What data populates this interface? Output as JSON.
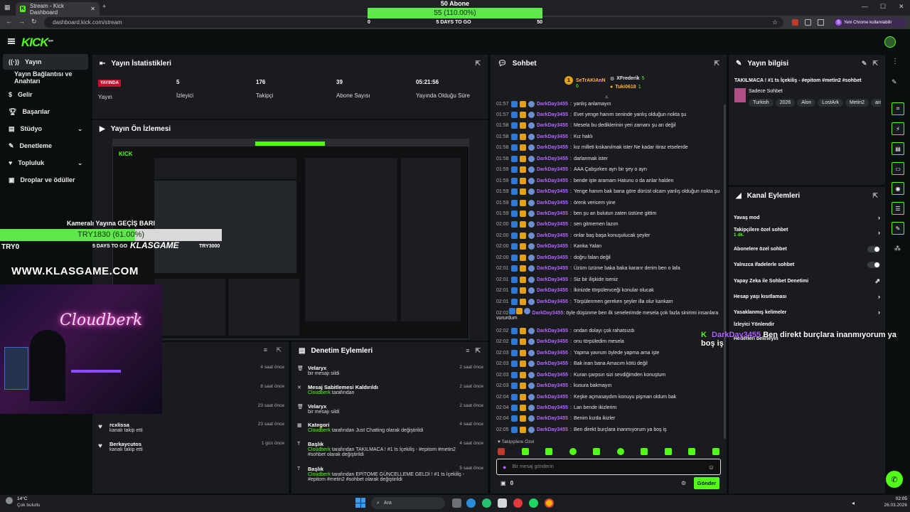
{
  "browser": {
    "tab_title": "Stream - Kick Dashboard",
    "new_tab": "+",
    "url": "dashboard.kick.com/stream",
    "profile_label": "Yeni Chrome kullanılabilir",
    "profile_initial": "S"
  },
  "goal_overlay": {
    "title": "50 Abone",
    "progress_label": "55 (110.00%)",
    "progress_fraction": 1.0,
    "min": "0",
    "days": "5 DAYS TO GO",
    "max": "50"
  },
  "header": {
    "logo": "KICK",
    "logo_sup": "BETA"
  },
  "sidebar": {
    "items": [
      {
        "label": "Yayın",
        "icon": "broadcast-icon"
      },
      {
        "label": "Yayın Bağlantısı ve Anahtarı",
        "icon": ""
      },
      {
        "label": "Gelir",
        "icon": "dollar-icon"
      },
      {
        "label": "Başarılar",
        "icon": "trophy-icon"
      },
      {
        "label": "Stüdyo",
        "icon": "studio-icon"
      },
      {
        "label": "Denetleme",
        "icon": "wrench-icon"
      },
      {
        "label": "Topluluk",
        "icon": "community-icon"
      },
      {
        "label": "Droplar ve ödüller",
        "icon": "gift-icon"
      }
    ]
  },
  "stats_panel": {
    "title": "Yayın İstatistikleri",
    "live_badge": "YAYINDA",
    "live_label": "Yayın",
    "stats": [
      {
        "value": "5",
        "label": "İzleyici"
      },
      {
        "value": "176",
        "label": "Takipçi"
      },
      {
        "value": "39",
        "label": "Abone Sayısı"
      },
      {
        "value": "05:21:56",
        "label": "Yayında Olduğu Süre"
      }
    ]
  },
  "preview_panel": {
    "title": "Yayın Ön İzlemesi"
  },
  "webcam_overlay": {
    "goal_title": "Kameralı Yayına GEÇİŞ BARI",
    "goal_value": "TRY1830 (61.00%)",
    "goal_fraction": 0.61,
    "min": "TRY0",
    "days": "5 DAYS TO GO",
    "max": "TRY3000",
    "sponsor": "KLASGAME",
    "sponsor_url": "WWW.KLASGAME.COM",
    "neon_sign": "Cloudberk"
  },
  "activity_panel": {
    "rows": [
      {
        "title": "",
        "sub": "",
        "time": "4 saat önce"
      },
      {
        "title": "",
        "sub": "",
        "time": "8 saat önce"
      },
      {
        "title": "",
        "sub": "",
        "time": "23 saat önce"
      },
      {
        "title": "rcxlissa",
        "sub": "kanalı takip etti",
        "time": "23 saat önce"
      },
      {
        "title": "Berkaycutos",
        "sub": "kanalı takip etti",
        "time": "1 gün önce"
      }
    ]
  },
  "moderation_panel": {
    "title": "Denetim Eylemleri",
    "rows": [
      {
        "title": "Velaryx",
        "actor": "",
        "sub": "bir mesajı sildi",
        "time": "2 saat önce"
      },
      {
        "title": "Mesaj Sabitlemesi Kaldırıldı",
        "actor": "Cloudberk",
        "sub": "tarafından",
        "time": "2 saat önce"
      },
      {
        "title": "Velaryx",
        "actor": "",
        "sub": "bir mesajı sildi",
        "time": "2 saat önce"
      },
      {
        "title": "Kategori",
        "actor": "Cloudberk",
        "sub": "tarafından Just Chatting olarak değiştirildi",
        "time": "4 saat önce"
      },
      {
        "title": "Başlık",
        "actor": "Cloudberk",
        "sub": "tarafından TAKILMACA ! #1 ts İçekiliş - #epitom #metin2 #sohbet olarak değiştirildi",
        "time": "4 saat önce"
      },
      {
        "title": "Başlık",
        "actor": "Cloudberk",
        "sub": "tarafından EPİTOME GÜNCELLEME GELDİ ! #1 ts İçekiliş - #epitom #metin2 #sohbet olarak değiştirildi",
        "time": "5 saat önce"
      }
    ]
  },
  "chat": {
    "title": "Sohbet",
    "top_gifters": [
      {
        "rank": "1",
        "name": "SeTrAKIAnN",
        "count": "6"
      },
      {
        "rank": "",
        "name": "XFrederik",
        "count": "5"
      },
      {
        "rank": "",
        "name": "Tuki0618",
        "count": "1"
      }
    ],
    "messages": [
      {
        "time": "01:57",
        "user": "DarkDay3455",
        "text": "yanlış anlamayın"
      },
      {
        "time": "01:57",
        "user": "DarkDay3455",
        "text": "Evet yenge hanım seninde yanlış olduğun nokta şu"
      },
      {
        "time": "01:58",
        "user": "DarkDay3455",
        "text": "Mesela bu dediklerinin yeri zamanı şu an değil"
      },
      {
        "time": "01:58",
        "user": "DarkDay3455",
        "text": "Kız haklı"
      },
      {
        "time": "01:58",
        "user": "DarkDay3455",
        "text": "kız milleti kıskanılmak ister Ne kadar itiraz etselerde"
      },
      {
        "time": "01:58",
        "user": "DarkDay3455",
        "text": "darlanmak ister"
      },
      {
        "time": "01:59",
        "user": "DarkDay3455",
        "text": "AAA Çabşırken ayrı bir şey o ayrı"
      },
      {
        "time": "01:59",
        "user": "DarkDay3455",
        "text": "bende işte aramam Hatunu o da anlar halden"
      },
      {
        "time": "01:59",
        "user": "DarkDay3455",
        "text": "Yenge hanım bak bana göre dürüst olcam yanlış olduğun nokta şu"
      },
      {
        "time": "01:59",
        "user": "DarkDay3455",
        "text": "örenk vericem yine"
      },
      {
        "time": "01:59",
        "user": "DarkDay3455",
        "text": "ben şu an bulutun zaten üstüne gittim"
      },
      {
        "time": "02:00",
        "user": "DarkDay3455",
        "text": "sen gitmemen lazım"
      },
      {
        "time": "02:00",
        "user": "DarkDay3455",
        "text": "onlar baş başa konuşulucak şeyler"
      },
      {
        "time": "02:00",
        "user": "DarkDay3455",
        "text": "Kanka Yalan"
      },
      {
        "time": "02:00",
        "user": "DarkDay3455",
        "text": "doğru falan değil"
      },
      {
        "time": "02:01",
        "user": "DarkDay3455",
        "text": "Üzüm üzüme baka baka kararır derim ben o lafa"
      },
      {
        "time": "02:01",
        "user": "DarkDay3455",
        "text": "Siz bir ilişkide iseniz"
      },
      {
        "time": "02:01",
        "user": "DarkDay3455",
        "text": "İkinizde törpülenıceği konular olucak"
      },
      {
        "time": "02:01",
        "user": "DarkDay3455",
        "text": "Törpülenmen gereken şeyler illa olur kankam"
      },
      {
        "time": "02:02",
        "user": "DarkDay3455",
        "text": "öyle düşünme ben ilk senelerimde mesela çok fazla sinirimi insanlara vururdum"
      },
      {
        "time": "02:02",
        "user": "DarkDay3455",
        "text": "ondan dolayı çok rahatsızdı"
      },
      {
        "time": "02:02",
        "user": "DarkDay3455",
        "text": "onu törpüledim mesela"
      },
      {
        "time": "02:03",
        "user": "DarkDay3455",
        "text": "Yapma yavrum öylede yapma ama işte"
      },
      {
        "time": "02:03",
        "user": "DarkDay3455",
        "text": "Bak inan bana Amacım kötü değil"
      },
      {
        "time": "02:03",
        "user": "DarkDay3455",
        "text": "Kuran çarpsın sizi sevdiğimden konuştum"
      },
      {
        "time": "02:03",
        "user": "DarkDay3455",
        "text": "kusura bakmayın"
      },
      {
        "time": "02:04",
        "user": "DarkDay3455",
        "text": "Keşke açmasaydım konuyu pişman oldum bak"
      },
      {
        "time": "02:04",
        "user": "DarkDay3455",
        "text": "Lan bende ikizlerim"
      },
      {
        "time": "02:04",
        "user": "DarkDay3455",
        "text": "Benim kızda ikizler"
      },
      {
        "time": "02:05",
        "user": "DarkDay3455",
        "text": "Ben direkt burçlara inanmıyorum ya boş iş"
      }
    ],
    "followers_only": "Takipçilere Özel",
    "input_placeholder": "Bir mesaj gönderin",
    "points": "0",
    "send_label": "Gönder"
  },
  "stream_info": {
    "title": "Yayın bilgisi",
    "stream_title": "TAKILMACA ! #1 ts İçekiliş - #epitom #metin2 #sohbet",
    "category": "Sadece Sohbet",
    "tags": [
      "Turkish",
      "2026",
      "Alon",
      "LostArk",
      "Metin2",
      "arcra"
    ]
  },
  "channel_actions": {
    "title": "Kanal Eylemleri",
    "items": [
      {
        "label": "Yavaş mod",
        "control": "arrow",
        "sub": ""
      },
      {
        "label": "Takipçilere özel sohbet",
        "control": "arrow",
        "sub": "1 dk."
      },
      {
        "label": "Abonelere özel sohbet",
        "control": "toggle",
        "sub": ""
      },
      {
        "label": "Yalnızca ifadelerle sohbet",
        "control": "toggle",
        "sub": ""
      },
      {
        "label": "Yapay Zeka ile Sohbet Denetimi",
        "control": "external",
        "sub": ""
      },
      {
        "label": "Hesap yaşı kısıtlaması",
        "control": "arrow",
        "sub": ""
      },
      {
        "label": "Yasaklanmış kelimeler",
        "control": "arrow",
        "sub": ""
      },
      {
        "label": "İzleyici Yönlendir",
        "control": "",
        "sub": ""
      },
      {
        "label": "Hedefleri belirleyin",
        "control": "",
        "sub": ""
      }
    ]
  },
  "floating_chat": {
    "user": "DarkDay3455",
    "text": "Ben direkt burçlara inanmıyorum ya boş iş"
  },
  "taskbar": {
    "weather_temp": "14°C",
    "weather_desc": "Çok bulutlu",
    "search": "Ara",
    "time": "02:05",
    "date": "26.03.2026"
  },
  "colors": {
    "accent": "#53fc18",
    "live": "#c8102e",
    "username": "#b565ff"
  }
}
